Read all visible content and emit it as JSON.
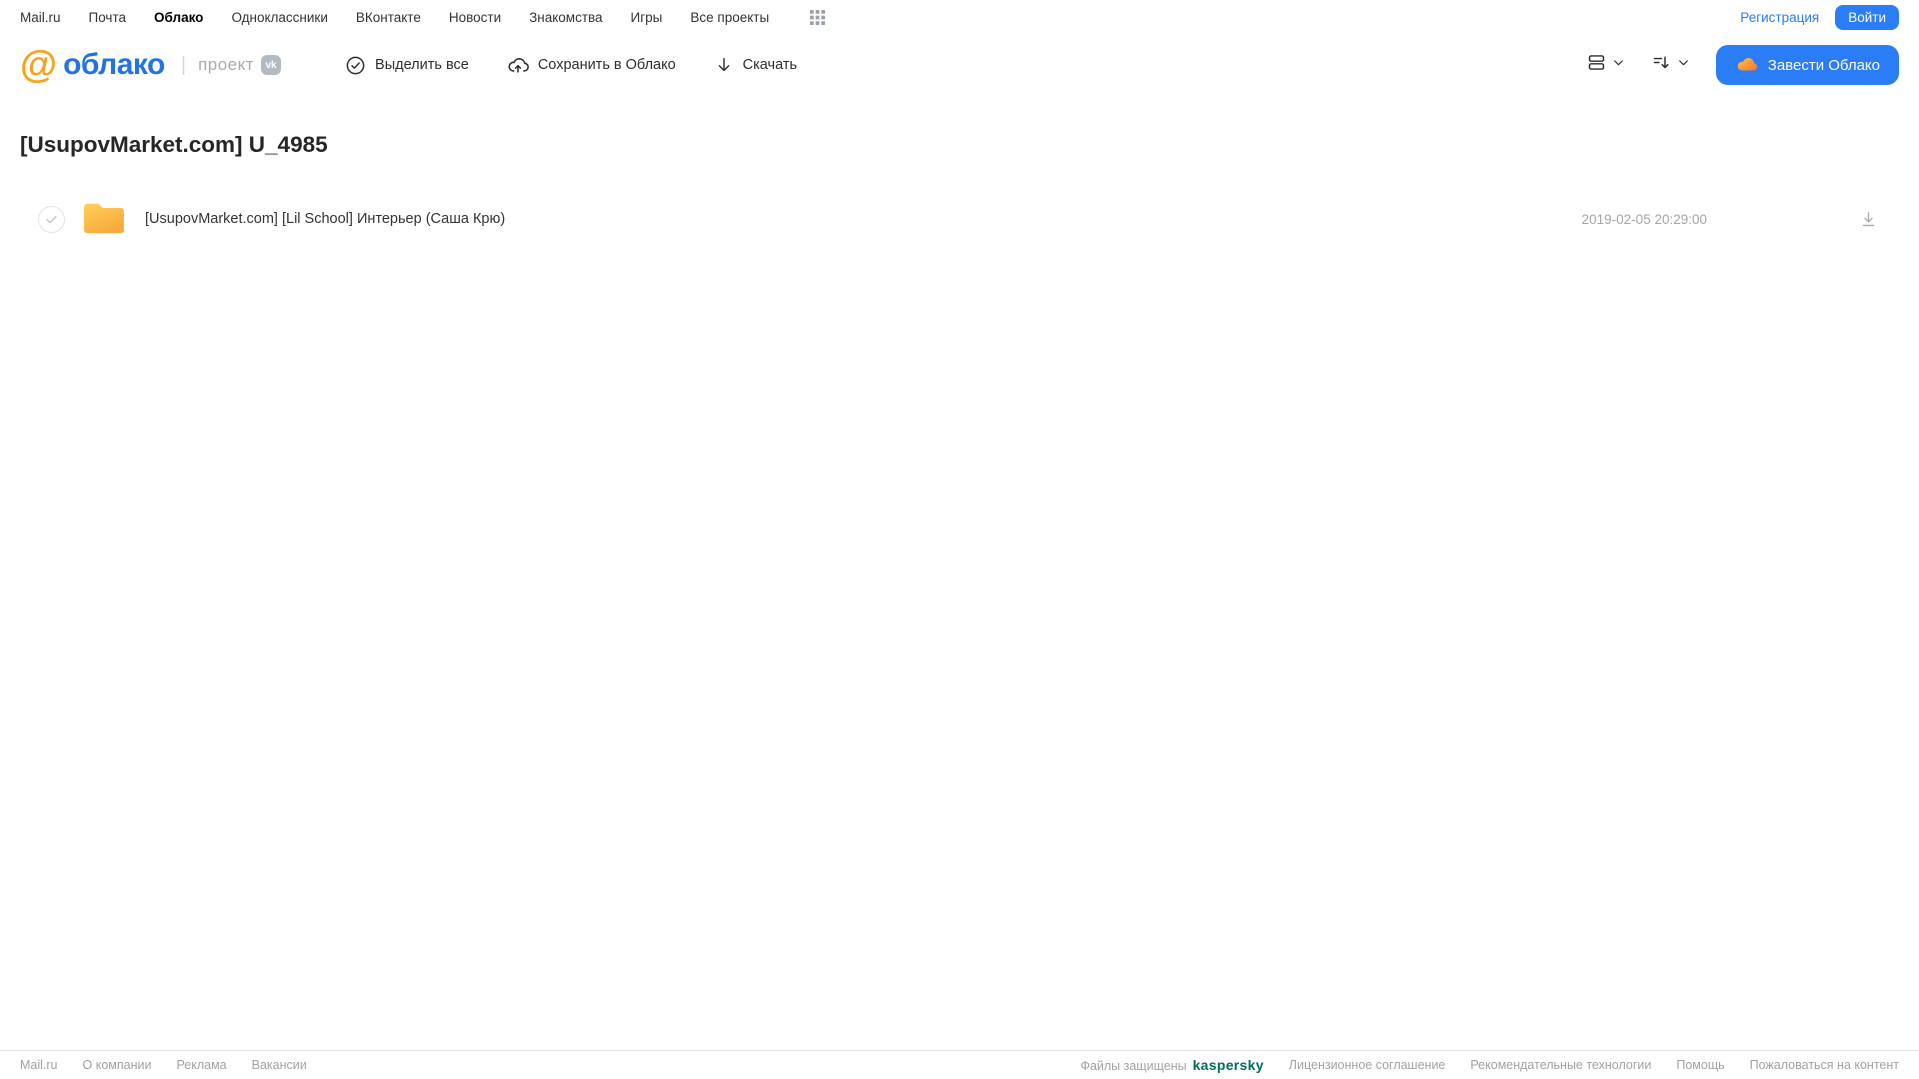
{
  "topnav": {
    "links": [
      "Mail.ru",
      "Почта",
      "Облако",
      "Одноклассники",
      "ВКонтакте",
      "Новости",
      "Знакомства",
      "Игры",
      "Все проекты"
    ],
    "active_link": "Облако",
    "registration": "Регистрация",
    "login": "Войти"
  },
  "header": {
    "logo_at": "@",
    "logo_text": "облако",
    "project_label": "проект",
    "vk_badge": "vk",
    "select_all": "Выделить все",
    "save_to_cloud": "Сохранить в Облако",
    "download": "Скачать",
    "get_cloud": "Завести Облако"
  },
  "main": {
    "title": "[UsupovMarket.com] U_4985",
    "file": {
      "name": "[UsupovMarket.com] [Lil School] Интерьер (Саша Крю)",
      "date": "2019-02-05 20:29:00"
    }
  },
  "footer": {
    "links_left": [
      "Mail.ru",
      "О компании",
      "Реклама",
      "Вакансии"
    ],
    "protected_label": "Файлы защищены",
    "kaspersky": "kaspersky",
    "links_right": [
      "Лицензионное соглашение",
      "Рекомендательные технологии",
      "Помощь",
      "Пожаловаться на контент"
    ]
  },
  "colors": {
    "accent_blue": "#2B7CF7",
    "logo_blue": "#2374DF",
    "logo_orange": "#F9A21E",
    "folder_yellow_top": "#FFCE5C",
    "folder_yellow_bottom": "#F8AB3C",
    "kaspersky_green": "#006D5C",
    "text_dark": "#2C2D2E",
    "text_gray": "#A5A5A5"
  }
}
